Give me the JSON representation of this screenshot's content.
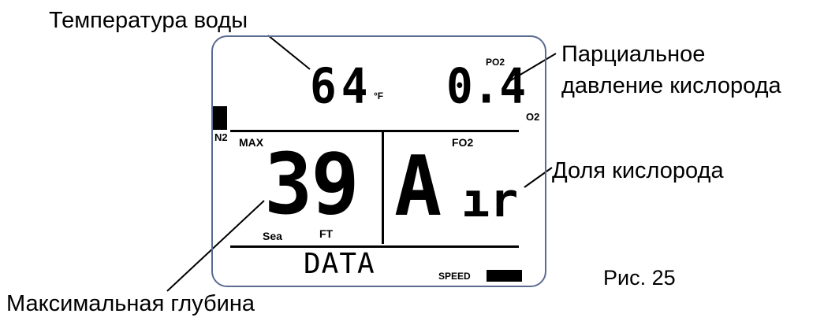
{
  "callouts": {
    "water_temp": "Температура воды",
    "partial_pressure_line1": "Парциальное",
    "partial_pressure_line2": "давление кислорода",
    "oxygen_fraction": "Доля кислорода",
    "max_depth": "Максимальная глубина"
  },
  "figure_label": "Рис. 25",
  "display": {
    "temperature": "64",
    "temp_unit": "°F",
    "po2_label": "PO2",
    "po2_value": "0.4",
    "o2_label": "O2",
    "n2_label": "N2",
    "max_label": "MAX",
    "depth_value": "39",
    "sea_label": "Sea",
    "ft_label": "FT",
    "fo2_label": "FO2",
    "air_a": "A",
    "air_ir": "ır",
    "data_label": "DATA",
    "speed_label": "SPEED"
  }
}
